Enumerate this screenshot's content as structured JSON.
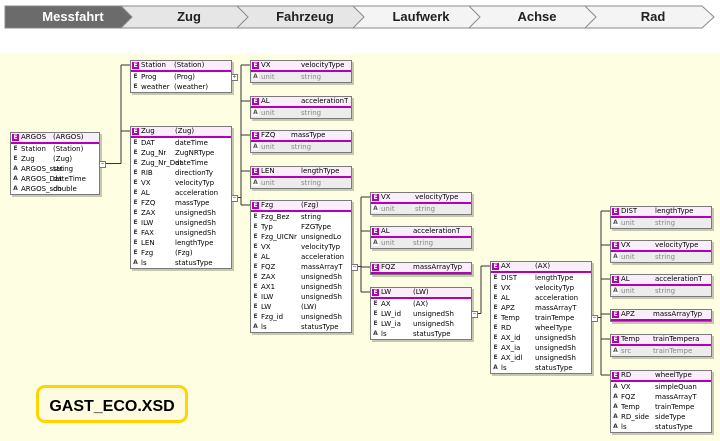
{
  "breadcrumb": [
    {
      "label": "Messfahrt",
      "active": true
    },
    {
      "label": "Zug",
      "active": false
    },
    {
      "label": "Fahrzeug",
      "active": false
    },
    {
      "label": "Laufwerk",
      "active": false
    },
    {
      "label": "Achse",
      "active": false
    },
    {
      "label": "Rad",
      "active": false
    }
  ],
  "title": "GAST_ECO.XSD",
  "colors": {
    "element_badge": "#b400b4",
    "canvas": "#fefee3",
    "active_crumb": "#6b6b6b",
    "title_border": "#ffd400"
  },
  "boxes": [
    {
      "id": "argos",
      "name": "ARGOS",
      "type": "(ARGOS)",
      "rows": [
        [
          "E",
          "Station",
          "(Station)"
        ],
        [
          "E",
          "Zug",
          "(Zug)"
        ],
        [
          "A",
          "ARGOS_stat",
          "string"
        ],
        [
          "A",
          "ARGOS_Dat",
          "dateTime"
        ],
        [
          "A",
          "ARGOS_sch",
          "double"
        ]
      ]
    },
    {
      "id": "station",
      "name": "Station",
      "type": "(Station)",
      "rows": [
        [
          "E",
          "Prog",
          "(Prog)"
        ],
        [
          "E",
          "weather",
          "(weather)"
        ]
      ]
    },
    {
      "id": "zug",
      "name": "Zug",
      "type": "(Zug)",
      "rows": [
        [
          "E",
          "DAT",
          "dateTime"
        ],
        [
          "E",
          "Zug_Nr",
          "ZugNRType"
        ],
        [
          "E",
          "Zug_Nr_Dat",
          "dateTime"
        ],
        [
          "E",
          "RIB",
          "directionTy"
        ],
        [
          "E",
          "VX",
          "velocityTyp"
        ],
        [
          "E",
          "AL",
          "acceleration"
        ],
        [
          "E",
          "FZQ",
          "massType"
        ],
        [
          "E",
          "ZAX",
          "unsignedSh"
        ],
        [
          "E",
          "ILW",
          "unsignedSh"
        ],
        [
          "E",
          "FAX",
          "unsignedSh"
        ],
        [
          "E",
          "LEN",
          "lengthType"
        ],
        [
          "E",
          "Fzg",
          "(Fzg)"
        ],
        [
          "A",
          "ls",
          "statusType"
        ]
      ]
    },
    {
      "id": "vx1",
      "name": "VX",
      "type": "velocityType",
      "rows": [
        [
          "A",
          "unit",
          "string"
        ]
      ]
    },
    {
      "id": "al1",
      "name": "AL",
      "type": "accelerationT",
      "rows": [
        [
          "A",
          "unit",
          "string"
        ]
      ]
    },
    {
      "id": "fzq1",
      "name": "FZQ",
      "type": "massType",
      "rows": [
        [
          "A",
          "unit",
          "string"
        ]
      ]
    },
    {
      "id": "len1",
      "name": "LEN",
      "type": "lengthType",
      "rows": [
        [
          "A",
          "unit",
          "string"
        ]
      ]
    },
    {
      "id": "fzg",
      "name": "Fzg",
      "type": "(Fzg)",
      "rows": [
        [
          "E",
          "Fzg_Bez",
          "string"
        ],
        [
          "E",
          "Typ",
          "FZGType"
        ],
        [
          "E",
          "Fzg_UICNr",
          "unsignedLo"
        ],
        [
          "E",
          "VX",
          "velocityTyp"
        ],
        [
          "E",
          "AL",
          "acceleration"
        ],
        [
          "E",
          "FQZ",
          "massArrayT"
        ],
        [
          "E",
          "ZAX",
          "unsignedSh"
        ],
        [
          "E",
          "AX1",
          "unsignedSh"
        ],
        [
          "E",
          "ILW",
          "unsignedSh"
        ],
        [
          "E",
          "LW",
          "(LW)"
        ],
        [
          "E",
          "Fzg_id",
          "unsignedSh"
        ],
        [
          "A",
          "ls",
          "statusType"
        ]
      ]
    },
    {
      "id": "vx2",
      "name": "VX",
      "type": "velocityType",
      "rows": [
        [
          "A",
          "unit",
          "string"
        ]
      ]
    },
    {
      "id": "al2",
      "name": "AL",
      "type": "accelerationT",
      "rows": [
        [
          "A",
          "unit",
          "string"
        ]
      ]
    },
    {
      "id": "fqz2",
      "name": "FQZ",
      "type": "massArrayTyp",
      "rows": []
    },
    {
      "id": "lw",
      "name": "LW",
      "type": "(LW)",
      "rows": [
        [
          "E",
          "AX",
          "(AX)"
        ],
        [
          "E",
          "LW_id",
          "unsignedSh"
        ],
        [
          "E",
          "LW_ia",
          "unsignedSh"
        ],
        [
          "A",
          "ls",
          "statusType"
        ]
      ]
    },
    {
      "id": "ax",
      "name": "AX",
      "type": "(AX)",
      "rows": [
        [
          "E",
          "DIST",
          "lengthType"
        ],
        [
          "E",
          "VX",
          "velocityTyp"
        ],
        [
          "E",
          "AL",
          "acceleration"
        ],
        [
          "E",
          "APZ",
          "massArrayT"
        ],
        [
          "E",
          "Temp",
          "trainTempe"
        ],
        [
          "E",
          "RD",
          "wheelType"
        ],
        [
          "E",
          "AX_id",
          "unsignedSh"
        ],
        [
          "E",
          "AX_ia",
          "unsignedSh"
        ],
        [
          "E",
          "AX_idl",
          "unsignedSh"
        ],
        [
          "A",
          "ls",
          "statusType"
        ]
      ]
    },
    {
      "id": "dist",
      "name": "DIST",
      "type": "lengthType",
      "rows": [
        [
          "A",
          "unit",
          "string"
        ]
      ]
    },
    {
      "id": "vx3",
      "name": "VX",
      "type": "velocityType",
      "rows": [
        [
          "A",
          "unit",
          "string"
        ]
      ]
    },
    {
      "id": "al3",
      "name": "AL",
      "type": "accelerationT",
      "rows": [
        [
          "A",
          "unit",
          "string"
        ]
      ]
    },
    {
      "id": "apz",
      "name": "APZ",
      "type": "massArrayTyp",
      "rows": []
    },
    {
      "id": "temp",
      "name": "Temp",
      "type": "trainTempera",
      "rows": [
        [
          "A",
          "src",
          "trainTempe"
        ]
      ]
    },
    {
      "id": "rd",
      "name": "RD",
      "type": "wheelType",
      "rows": [
        [
          "A",
          "VX",
          "simpleQuan"
        ],
        [
          "A",
          "FQZ",
          "massArrayT"
        ],
        [
          "A",
          "Temp",
          "trainTempe"
        ],
        [
          "A",
          "RD_side",
          "sideType"
        ],
        [
          "A",
          "ls",
          "statusType"
        ]
      ]
    }
  ]
}
